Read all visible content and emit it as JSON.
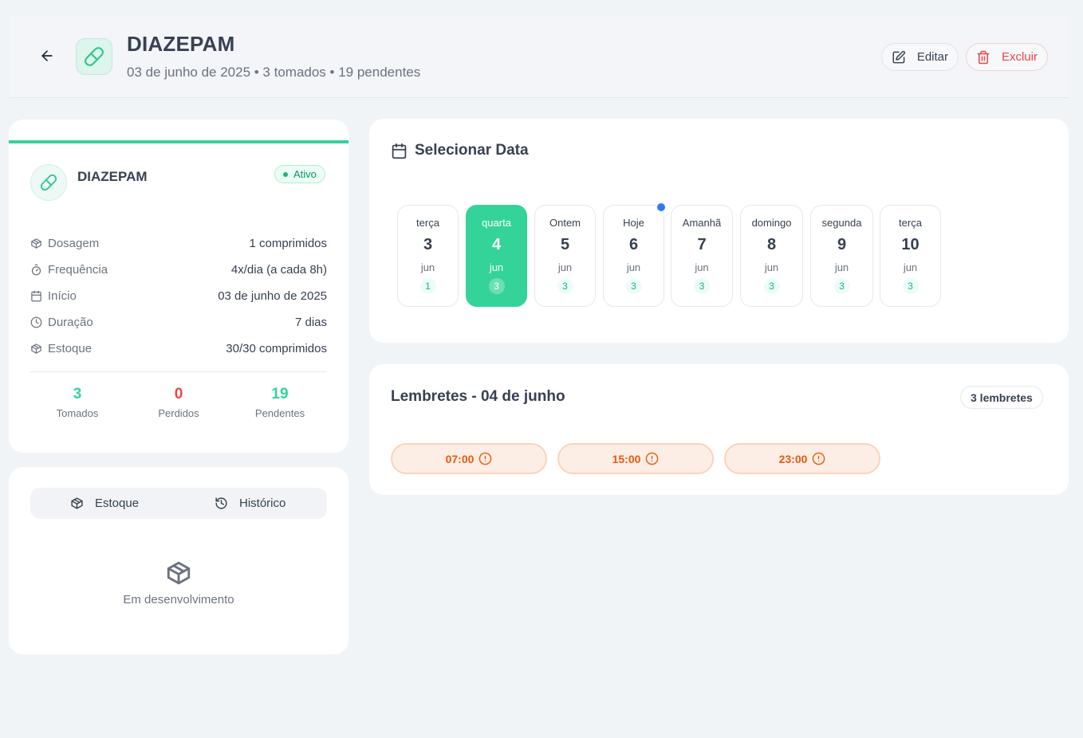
{
  "header": {
    "title": "DIAZEPAM",
    "subtitle": "03 de junho de 2025 • 3 tomados • 19 pendentes",
    "edit_label": "Editar",
    "delete_label": "Excluir"
  },
  "info": {
    "name": "DIAZEPAM",
    "status": "Ativo",
    "rows": [
      {
        "label": "Dosagem",
        "value": "1 comprimidos",
        "icon": "package-icon"
      },
      {
        "label": "Frequência",
        "value": "4x/dia (a cada 8h)",
        "icon": "timer-icon"
      },
      {
        "label": "Início",
        "value": "03 de junho de 2025",
        "icon": "calendar-icon"
      },
      {
        "label": "Duração",
        "value": "7 dias",
        "icon": "clock-icon"
      },
      {
        "label": "Estoque",
        "value": "30/30 comprimidos",
        "icon": "package-icon"
      }
    ],
    "stats": [
      {
        "value": "3",
        "label": "Tomados",
        "color": "#34d399"
      },
      {
        "value": "0",
        "label": "Perdidos",
        "color": "#ef4444"
      },
      {
        "value": "19",
        "label": "Pendentes",
        "color": "#34d399"
      }
    ]
  },
  "stock": {
    "tabs": [
      "Estoque",
      "Histórico"
    ],
    "empty_text": "Em desenvolvimento"
  },
  "date_picker": {
    "title": "Selecionar Data",
    "days": [
      {
        "name": "terça",
        "num": "3",
        "month": "jun",
        "count": "1"
      },
      {
        "name": "quarta",
        "num": "4",
        "month": "jun",
        "count": "3",
        "selected": true
      },
      {
        "name": "Ontem",
        "num": "5",
        "month": "jun",
        "count": "3"
      },
      {
        "name": "Hoje",
        "num": "6",
        "month": "jun",
        "count": "3",
        "today": true
      },
      {
        "name": "Amanhã",
        "num": "7",
        "month": "jun",
        "count": "3"
      },
      {
        "name": "domingo",
        "num": "8",
        "month": "jun",
        "count": "3"
      },
      {
        "name": "segunda",
        "num": "9",
        "month": "jun",
        "count": "3"
      },
      {
        "name": "terça",
        "num": "10",
        "month": "jun",
        "count": "3"
      }
    ]
  },
  "reminders": {
    "title": "Lembretes - 04 de junho",
    "count_label": "3 lembretes",
    "times": [
      "07:00",
      "15:00",
      "23:00"
    ]
  },
  "colors": {
    "accent": "#34d399",
    "danger": "#ef4444",
    "warning": "#ea580c",
    "today_dot": "#2f7bf6"
  }
}
